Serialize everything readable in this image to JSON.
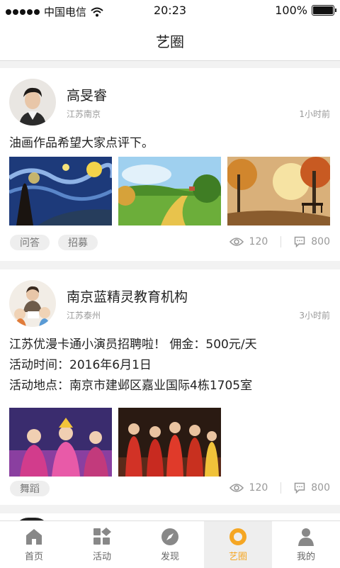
{
  "status_bar": {
    "carrier": "中国电信",
    "time": "20:23",
    "battery": "100%"
  },
  "header": {
    "title": "艺圈"
  },
  "posts": [
    {
      "author": "高旻睿",
      "location": "江苏南京",
      "time": "1小时前",
      "content": [
        "油画作品希望大家点评下。"
      ],
      "tags": [
        "问答",
        "招募"
      ],
      "views": "120",
      "comments": "800"
    },
    {
      "author": "南京蓝精灵教育机构",
      "location": "江苏泰州",
      "time": "3小时前",
      "content": [
        "江苏优漫卡通小演员招聘啦！ 佣金：500元/天",
        "活动时间：2016年6月1日",
        "活动地点：南京市建邺区嘉业国际4栋1705室"
      ],
      "tags": [
        "舞蹈"
      ],
      "views": "120",
      "comments": "800"
    }
  ],
  "tabbar": {
    "items": [
      {
        "label": "首页",
        "icon": "home-icon"
      },
      {
        "label": "活动",
        "icon": "grid-icon"
      },
      {
        "label": "发现",
        "icon": "compass-icon"
      },
      {
        "label": "艺圈",
        "icon": "circle-icon",
        "active": true
      },
      {
        "label": "我的",
        "icon": "person-icon"
      }
    ]
  },
  "colors": {
    "accent": "#f5a623",
    "text": "#222222",
    "muted": "#999999"
  }
}
